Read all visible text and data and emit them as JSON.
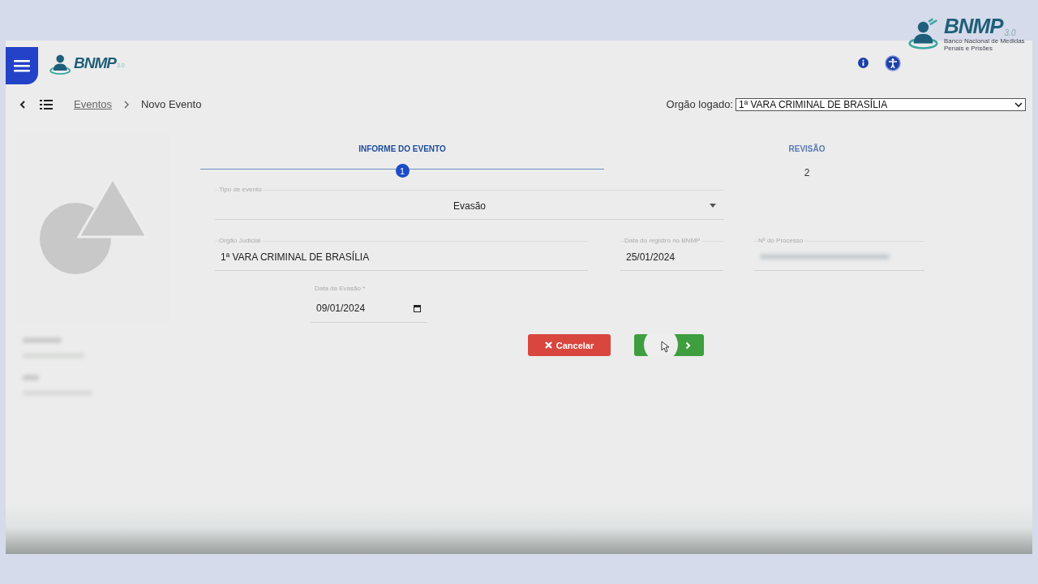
{
  "header": {
    "logo": {
      "name": "BNMP",
      "version": "3.0"
    }
  },
  "brand_overlay": {
    "name": "BNMP",
    "version": "3.0",
    "tagline": "Banco Nacional de Medidas Penais e Prisões"
  },
  "breadcrumb": [
    {
      "label": "Eventos",
      "kind": "link"
    },
    {
      "label": "Novo Evento",
      "kind": "current"
    }
  ],
  "orgao_logado": {
    "label": "Orgão logado:",
    "value": "1ª VARA CRIMINAL DE BRASÍLIA"
  },
  "steps": [
    {
      "title": "INFORME DO EVENTO",
      "number": "1",
      "selected": true
    },
    {
      "title": "REVISÃO",
      "number": "2",
      "selected": false
    }
  ],
  "fields": [
    {
      "label": "Tipo de evento",
      "value": "Evasão",
      "kind": "select"
    },
    {
      "label": "Orgão Judicial",
      "value": "1ª VARA CRIMINAL DE BRASÍLIA",
      "kind": "text"
    },
    {
      "label": "Data do registro no BNMP",
      "value": "25/01/2024",
      "kind": "text"
    },
    {
      "label": "Nº do Processo",
      "kind": "blurred"
    },
    {
      "label": "Data da Evasão *",
      "value": "09/01/2024",
      "kind": "date"
    }
  ],
  "buttons": [
    {
      "label": "Cancelar",
      "kind": "cancel"
    },
    {
      "kind": "next"
    }
  ]
}
